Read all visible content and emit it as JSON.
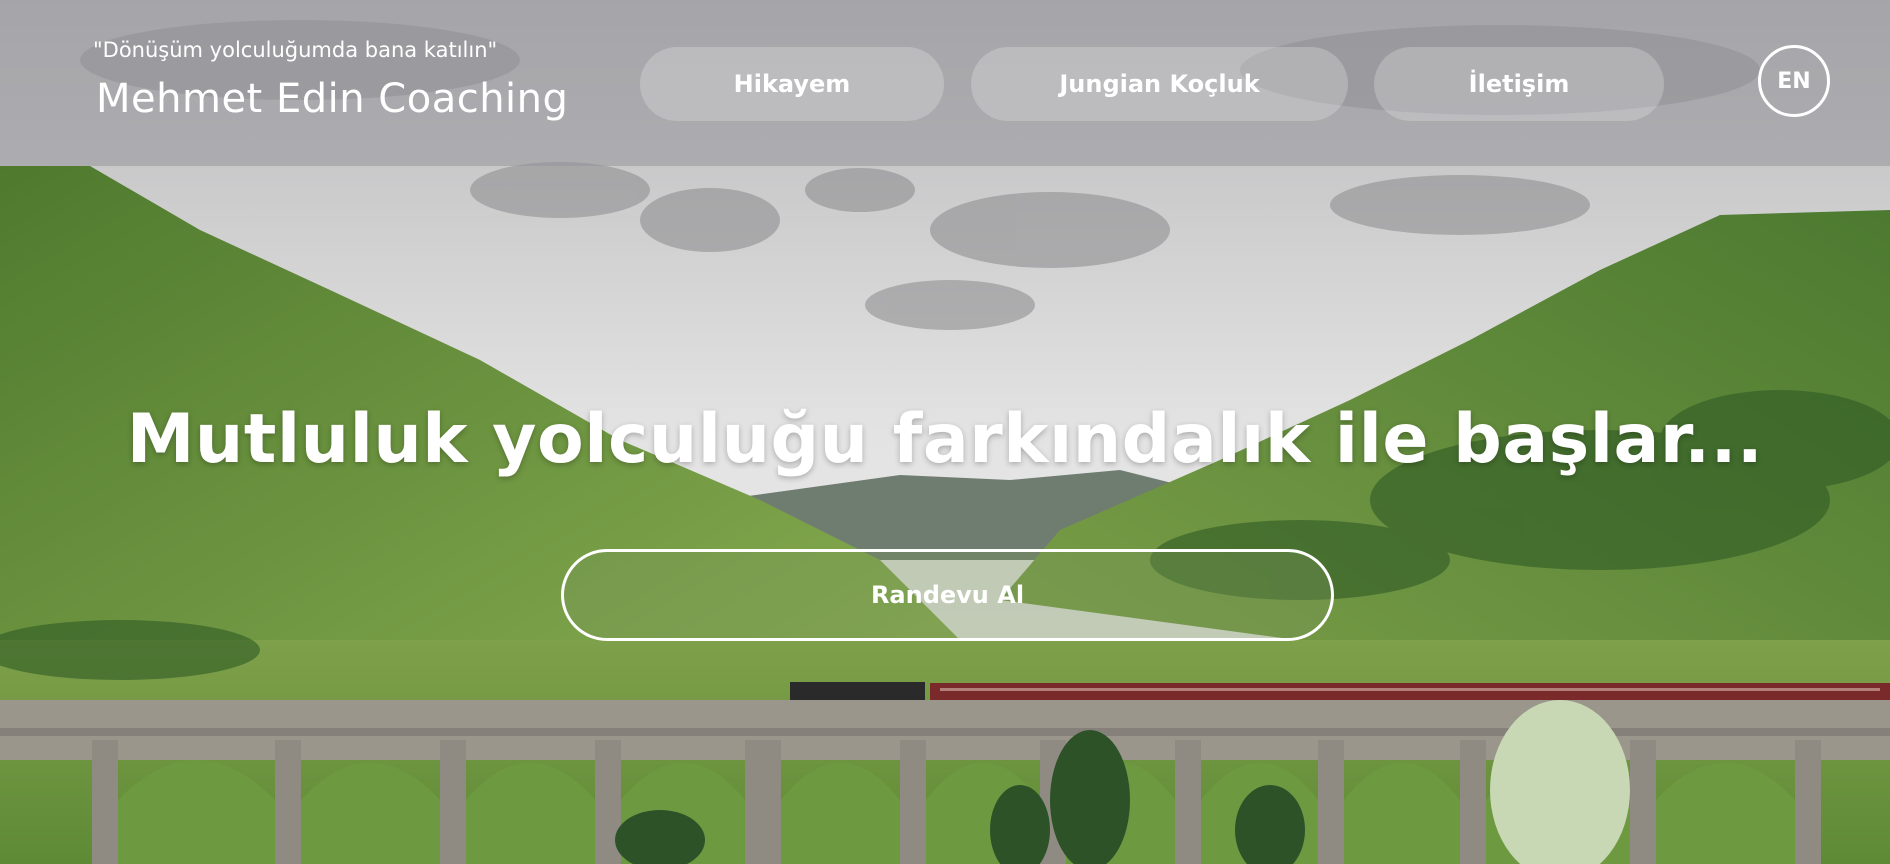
{
  "header": {
    "tagline": "\"Dönüşüm yolculuğumda bana katılın\"",
    "brand": "Mehmet Edin Coaching",
    "nav": [
      {
        "label": "Hikayem"
      },
      {
        "label": "Jungian Koçluk"
      },
      {
        "label": "İletişim"
      }
    ],
    "language_button": "EN"
  },
  "hero": {
    "headline": "Mutluluk yolculuğu farkındalık ile başlar...",
    "cta_label": "Randevu Al",
    "background_image": "scenic green valley with stone arch viaduct and red steam train"
  },
  "colors": {
    "text": "#ffffff",
    "header_overlay": "#96969b",
    "hill_green": "#5e8a3a",
    "sky": "#d9d9d9",
    "train": "#7a2a2a",
    "viaduct": "#9a968c"
  }
}
